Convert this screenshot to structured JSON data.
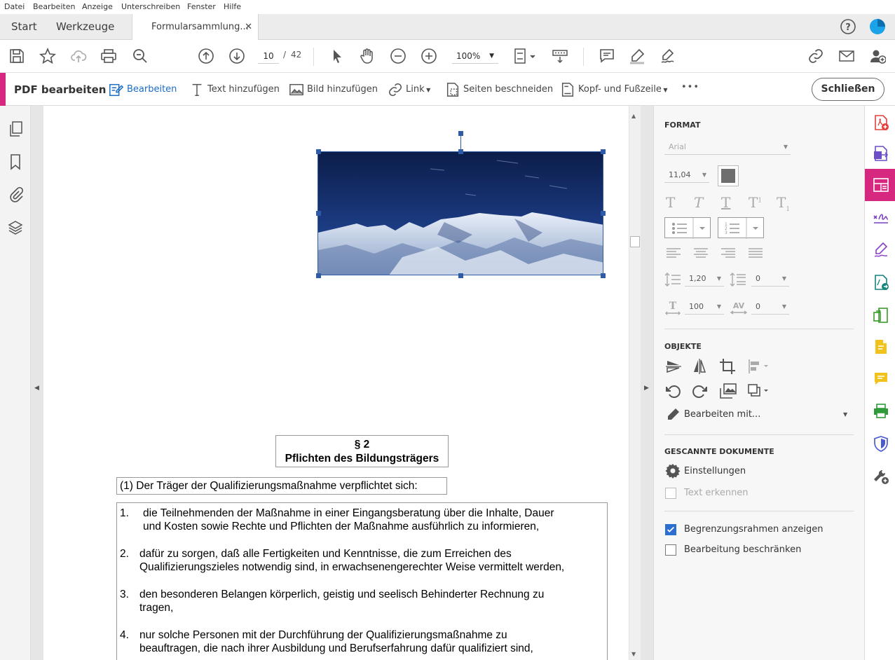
{
  "menu": [
    "Datei",
    "Bearbeiten",
    "Anzeige",
    "Unterschreiben",
    "Fenster",
    "Hilfe"
  ],
  "tabs": {
    "start": "Start",
    "tools": "Werkzeuge",
    "document": "Formularsammlung...",
    "close": "✕"
  },
  "toolbar": {
    "page_current": "10",
    "page_sep": "/",
    "page_total": "42",
    "zoom": "100%"
  },
  "editbar": {
    "title": "PDF bearbeiten",
    "edit": "Bearbeiten",
    "add_text": "Text hinzufügen",
    "add_image": "Bild hinzufügen",
    "link": "Link",
    "crop": "Seiten beschneiden",
    "header_footer": "Kopf- und Fußzeile",
    "more": "•••",
    "close": "Schließen"
  },
  "panel": {
    "format_header": "FORMAT",
    "font": "Arial",
    "font_size": "11,04",
    "line_spacing": "1,20",
    "para_spacing": "0",
    "scale": "100",
    "char_spacing": "0",
    "objects_header": "OBJEKTE",
    "edit_with": "Bearbeiten mit...",
    "scanned_header": "GESCANNTE DOKUMENTE",
    "settings": "Einstellungen",
    "recognize_text": "Text erkennen",
    "show_bbox": "Begrenzungsrahmen anzeigen",
    "restrict_edit": "Bearbeitung beschränken",
    "show_bbox_checked": true,
    "restrict_edit_checked": false
  },
  "document": {
    "section_num": "§ 2",
    "section_title": "Pflichten des Bildungsträgers",
    "intro": "(1) Der Träger der Qualifizierungsmaßnahme verpflichtet sich:",
    "items": [
      {
        "n": "1.",
        "l1": "die Teilnehmenden der Maßnahme in einer Eingangsberatung über die Inhalte, Dauer",
        "l2": "und Kosten sowie Rechte und Pflichten der Maßnahme ausführlich zu informieren,"
      },
      {
        "n": "2.",
        "l1": "dafür zu sorgen, daß alle Fertigkeiten und Kenntnisse, die zum Erreichen des",
        "l2": "Qualifizierungszieles notwendig sind, in erwachsenengerechter Weise vermittelt werden,"
      },
      {
        "n": "3.",
        "l1": "den besonderen Belangen körperlich, geistig und seelisch Behinderter Rechnung zu",
        "l2": "tragen,"
      },
      {
        "n": "4.",
        "l1": "nur solche Personen mit der Durchführung der Qualifizierungsmaßnahme zu",
        "l2": "beauftragen, die nach ihrer Ausbildung und Berufserfahrung dafür qualifiziert sind,"
      }
    ]
  },
  "colors": {
    "accent": "#d6287e",
    "link_blue": "#1a6cc7",
    "selection": "#2e5aa8"
  }
}
